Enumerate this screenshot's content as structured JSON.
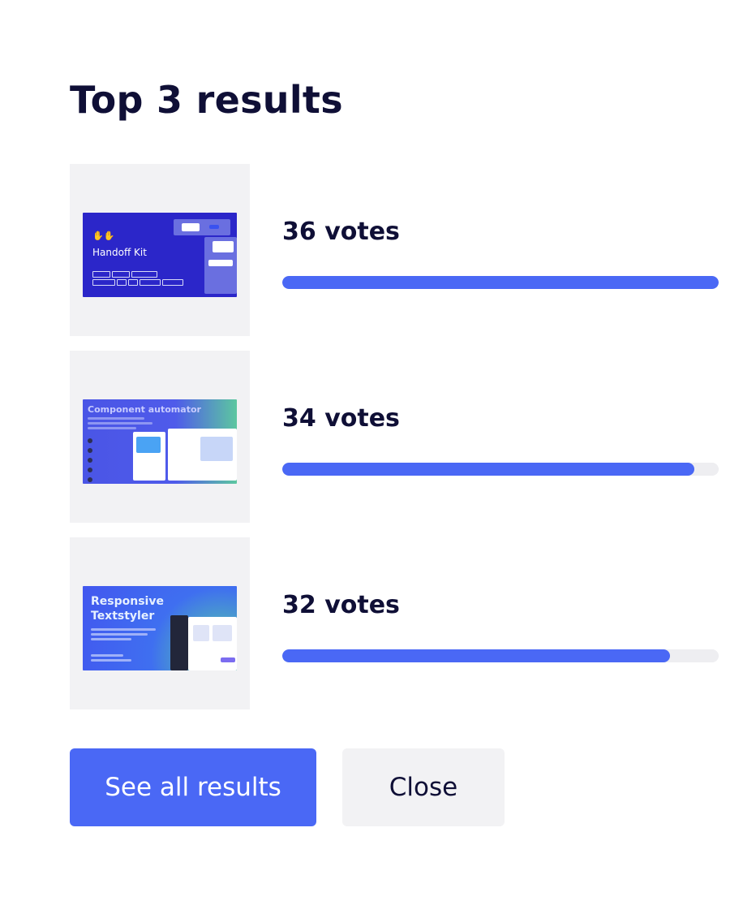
{
  "heading": {
    "title": "Top 3 results"
  },
  "results": [
    {
      "thumbnail_title": "Handoff Kit",
      "votes_label": "36 votes",
      "share": 1.0
    },
    {
      "thumbnail_title": "Component automator",
      "votes_label": "34 votes",
      "share": 0.944
    },
    {
      "thumbnail_title": "Responsive Textstyler",
      "votes_label": "32 votes",
      "share": 0.889
    }
  ],
  "actions": {
    "see_all_label": "See all results",
    "close_label": "Close"
  },
  "colors": {
    "accent": "#4a68f5",
    "track": "#eeeef1",
    "text": "#0f0f36",
    "thumb_bg": "#f2f2f4"
  }
}
